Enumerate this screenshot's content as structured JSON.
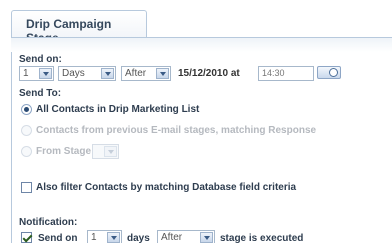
{
  "tab": {
    "label": "Drip Campaign Stage"
  },
  "send_on": {
    "label": "Send on:",
    "count": "1",
    "unit": "Days",
    "relation": "After",
    "date": "15/12/2010 at",
    "time": "14:30"
  },
  "send_to": {
    "label": "Send To:",
    "options": [
      {
        "label": "All Contacts in Drip Marketing List",
        "selected": true,
        "enabled": true
      },
      {
        "label": "Contacts from previous E-mail stages, matching Response",
        "selected": false,
        "enabled": false
      },
      {
        "label": "From Stage",
        "selected": false,
        "enabled": false
      }
    ],
    "from_stage_value": ""
  },
  "filter": {
    "label": "Also filter Contacts by matching Database field criteria",
    "checked": false
  },
  "notification": {
    "label": "Notification:",
    "checked": true,
    "prefix": "Send on",
    "count": "1",
    "days_label": "days",
    "relation": "After",
    "suffix": "stage is executed"
  }
}
